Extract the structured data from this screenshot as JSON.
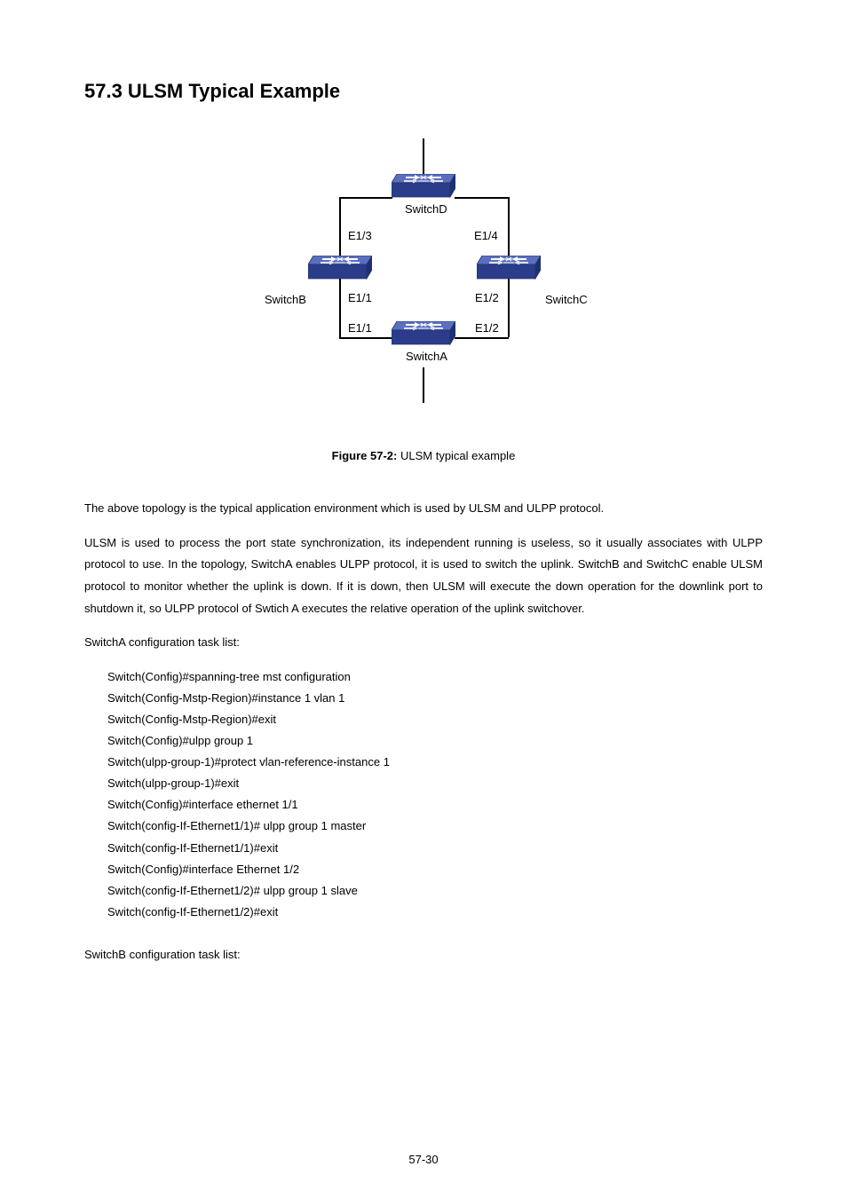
{
  "heading": "57.3 ULSM Typical Example",
  "diagram": {
    "switchD": "SwitchD",
    "switchB": "SwitchB",
    "switchC": "SwitchC",
    "switchA": "SwitchA",
    "e13": "E1/3",
    "e14": "E1/4",
    "e11L": "E1/1",
    "e12R": "E1/2",
    "e11B": "E1/1",
    "e12B": "E1/2"
  },
  "caption_bold": "Figure 57-2:",
  "caption_rest": " ULSM typical example",
  "para1": "The above topology is the typical application environment which is used by ULSM and ULPP protocol.",
  "para2": "ULSM is used to process the port state synchronization, its independent running is useless, so it usually associates with ULPP protocol to use. In the topology, SwitchA enables ULPP protocol, it is used to switch the uplink. SwitchB and SwitchC enable ULSM protocol to monitor whether the uplink is down. If it is down, then ULSM will execute the down operation for the downlink port to shutdown it, so ULPP protocol of Swtich A executes the relative operation of the uplink switchover.",
  "para3": "SwitchA configuration task list:",
  "code": [
    "Switch(Config)#spanning-tree mst configuration",
    "Switch(Config-Mstp-Region)#instance 1 vlan 1",
    "Switch(Config-Mstp-Region)#exit",
    "Switch(Config)#ulpp group 1",
    "Switch(ulpp-group-1)#protect vlan-reference-instance 1",
    "Switch(ulpp-group-1)#exit",
    "Switch(Config)#interface ethernet 1/1",
    "Switch(config-If-Ethernet1/1)# ulpp group 1 master",
    "Switch(config-If-Ethernet1/1)#exit",
    "Switch(Config)#interface Ethernet 1/2",
    "Switch(config-If-Ethernet1/2)# ulpp group 1 slave",
    "Switch(config-If-Ethernet1/2)#exit"
  ],
  "para4": "SwitchB configuration task list:",
  "page_num": "57-30"
}
